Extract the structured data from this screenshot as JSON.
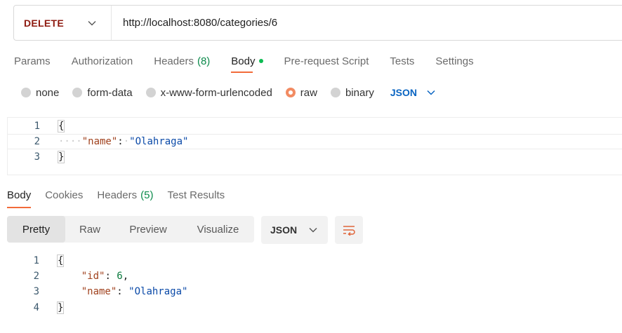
{
  "request": {
    "method": "DELETE",
    "url": "http://localhost:8080/categories/6"
  },
  "request_tabs": {
    "params": "Params",
    "authorization": "Authorization",
    "headers": "Headers",
    "headers_count": "(8)",
    "body": "Body",
    "prerequest": "Pre-request Script",
    "tests": "Tests",
    "settings": "Settings"
  },
  "body_types": {
    "none": "none",
    "form_data": "form-data",
    "urlencoded": "x-www-form-urlencoded",
    "raw": "raw",
    "binary": "binary",
    "selected": "raw",
    "language": "JSON"
  },
  "request_editor": {
    "line_numbers": [
      "1",
      "2",
      "3"
    ],
    "line1": "{",
    "line2_indent": "····",
    "line2_key": "\"name\"",
    "line2_colon": ":",
    "line2_space": "·",
    "line2_value": "\"Olahraga\"",
    "line3": "}"
  },
  "response_tabs": {
    "body": "Body",
    "cookies": "Cookies",
    "headers": "Headers",
    "headers_count": "(5)",
    "test_results": "Test Results"
  },
  "response_view": {
    "pretty": "Pretty",
    "raw": "Raw",
    "preview": "Preview",
    "visualize": "Visualize",
    "format": "JSON"
  },
  "response_body": {
    "line_numbers": [
      "1",
      "2",
      "3",
      "4"
    ],
    "line1": "{",
    "id_key": "\"id\"",
    "id_value": "6",
    "name_key": "\"name\"",
    "name_value": "\"Olahraga\"",
    "line4": "}"
  },
  "colors": {
    "accent": "#f26b3a",
    "method": "#8e1a10",
    "json_string": "#0b4aa8",
    "json_key": "#a0411d",
    "count_green": "#0b8a4b"
  }
}
